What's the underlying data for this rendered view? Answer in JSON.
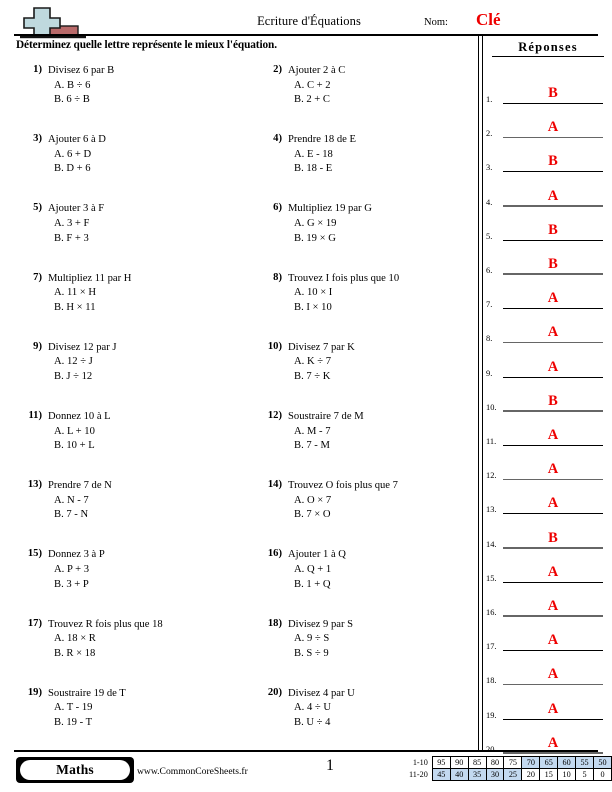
{
  "header": {
    "title": "Ecriture d'Équations",
    "name_label": "Nom:",
    "name_value": "Clé",
    "logo_name": "math-plus-logo"
  },
  "instructions": "Déterminez quelle lettre représente le mieux l'équation.",
  "answers_panel": {
    "title": "Réponses",
    "items": [
      {
        "num": "1.",
        "value": "B"
      },
      {
        "num": "2.",
        "value": "A"
      },
      {
        "num": "3.",
        "value": "B"
      },
      {
        "num": "4.",
        "value": "A"
      },
      {
        "num": "5.",
        "value": "B"
      },
      {
        "num": "6.",
        "value": "B"
      },
      {
        "num": "7.",
        "value": "A"
      },
      {
        "num": "8.",
        "value": "A"
      },
      {
        "num": "9.",
        "value": "A"
      },
      {
        "num": "10.",
        "value": "B"
      },
      {
        "num": "11.",
        "value": "A"
      },
      {
        "num": "12.",
        "value": "A"
      },
      {
        "num": "13.",
        "value": "A"
      },
      {
        "num": "14.",
        "value": "B"
      },
      {
        "num": "15.",
        "value": "A"
      },
      {
        "num": "16.",
        "value": "A"
      },
      {
        "num": "17.",
        "value": "A"
      },
      {
        "num": "18.",
        "value": "A"
      },
      {
        "num": "19.",
        "value": "A"
      },
      {
        "num": "20.",
        "value": "A"
      }
    ]
  },
  "questions": [
    {
      "num": "1)",
      "text": "Divisez 6 par B",
      "a": "A. B ÷ 6",
      "b": "B. 6 ÷ B"
    },
    {
      "num": "2)",
      "text": "Ajouter 2 à C",
      "a": "A. C + 2",
      "b": "B. 2 + C"
    },
    {
      "num": "3)",
      "text": "Ajouter 6 à D",
      "a": "A. 6 + D",
      "b": "B. D + 6"
    },
    {
      "num": "4)",
      "text": "Prendre 18 de E",
      "a": "A. E - 18",
      "b": "B. 18 - E"
    },
    {
      "num": "5)",
      "text": "Ajouter 3 à F",
      "a": "A. 3 + F",
      "b": "B. F + 3"
    },
    {
      "num": "6)",
      "text": "Multipliez 19 par G",
      "a": "A. G × 19",
      "b": "B. 19 × G"
    },
    {
      "num": "7)",
      "text": "Multipliez 11 par H",
      "a": "A. 11 × H",
      "b": "B. H × 11"
    },
    {
      "num": "8)",
      "text": "Trouvez I fois plus que 10",
      "a": "A. 10 × I",
      "b": "B. I × 10"
    },
    {
      "num": "9)",
      "text": "Divisez 12 par J",
      "a": "A. 12 ÷ J",
      "b": "B. J ÷ 12"
    },
    {
      "num": "10)",
      "text": "Divisez 7 par K",
      "a": "A. K ÷ 7",
      "b": "B. 7 ÷ K"
    },
    {
      "num": "11)",
      "text": "Donnez 10 à L",
      "a": "A. L + 10",
      "b": "B. 10 + L"
    },
    {
      "num": "12)",
      "text": "Soustraire 7 de M",
      "a": "A. M - 7",
      "b": "B. 7 - M"
    },
    {
      "num": "13)",
      "text": "Prendre 7 de N",
      "a": "A. N - 7",
      "b": "B. 7 - N"
    },
    {
      "num": "14)",
      "text": "Trouvez O fois plus que 7",
      "a": "A. O × 7",
      "b": "B. 7 × O"
    },
    {
      "num": "15)",
      "text": "Donnez 3 à P",
      "a": "A. P + 3",
      "b": "B. 3 + P"
    },
    {
      "num": "16)",
      "text": "Ajouter 1 à Q",
      "a": "A. Q + 1",
      "b": "B. 1 + Q"
    },
    {
      "num": "17)",
      "text": "Trouvez R fois plus que 18",
      "a": "A. 18 × R",
      "b": "B. R × 18"
    },
    {
      "num": "18)",
      "text": "Divisez 9 par S",
      "a": "A. 9 ÷ S",
      "b": "B. S ÷ 9"
    },
    {
      "num": "19)",
      "text": "Soustraire 19 de T",
      "a": "A. T - 19",
      "b": "B. 19 - T"
    },
    {
      "num": "20)",
      "text": "Divisez 4 par U",
      "a": "A. 4 ÷ U",
      "b": "B. U ÷ 4"
    }
  ],
  "footer": {
    "subject_badge": "Maths",
    "site": "www.CommonCoreSheets.fr",
    "page_number": "1"
  },
  "score_table": {
    "highlight_color": "#c3d9f0",
    "rows": [
      {
        "label": "1-10",
        "cells": [
          {
            "v": "95",
            "hl": false
          },
          {
            "v": "90",
            "hl": false
          },
          {
            "v": "85",
            "hl": false
          },
          {
            "v": "80",
            "hl": false
          },
          {
            "v": "75",
            "hl": false
          },
          {
            "v": "70",
            "hl": true
          },
          {
            "v": "65",
            "hl": true
          },
          {
            "v": "60",
            "hl": true
          },
          {
            "v": "55",
            "hl": true
          },
          {
            "v": "50",
            "hl": true
          }
        ]
      },
      {
        "label": "11-20",
        "cells": [
          {
            "v": "45",
            "hl": true
          },
          {
            "v": "40",
            "hl": true
          },
          {
            "v": "35",
            "hl": true
          },
          {
            "v": "30",
            "hl": true
          },
          {
            "v": "25",
            "hl": true
          },
          {
            "v": "20",
            "hl": false
          },
          {
            "v": "15",
            "hl": false
          },
          {
            "v": "10",
            "hl": false
          },
          {
            "v": "5",
            "hl": false
          },
          {
            "v": "0",
            "hl": false
          }
        ]
      }
    ]
  }
}
